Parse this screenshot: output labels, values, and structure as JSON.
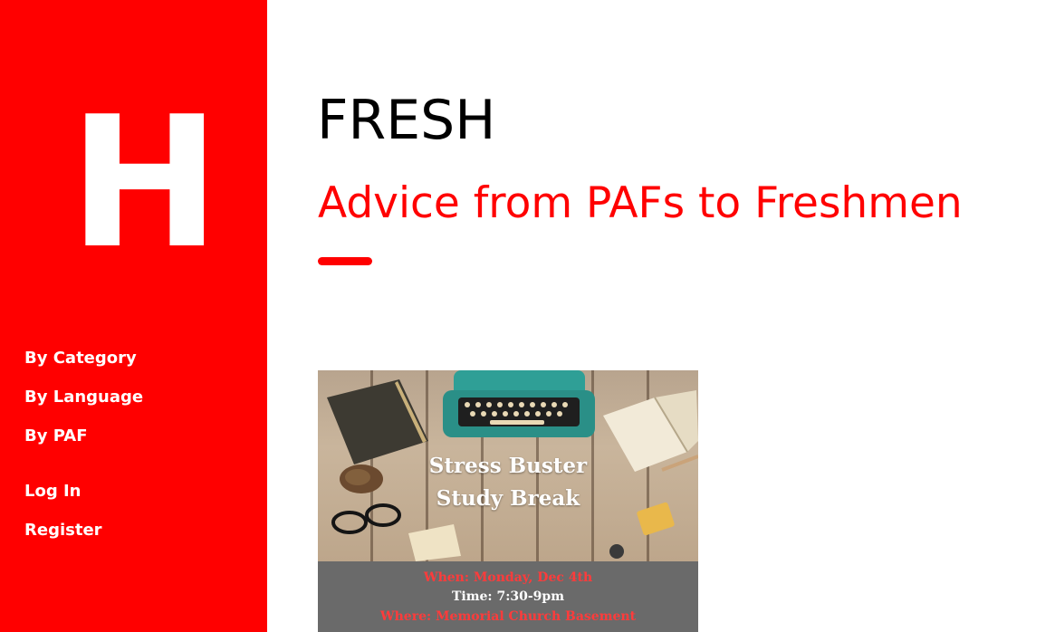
{
  "sidebar": {
    "logo_letter": "H",
    "nav": [
      {
        "label": "By Category"
      },
      {
        "label": "By Language"
      },
      {
        "label": "By PAF"
      }
    ],
    "account": [
      {
        "label": "Log In"
      },
      {
        "label": "Register"
      }
    ]
  },
  "header": {
    "title": "FRESH",
    "subtitle": "Advice from PAFs to Freshmen"
  },
  "post": {
    "flyer": {
      "headline_line1": "Stress Buster",
      "headline_line2": "Study Break",
      "when": "When: Monday, Dec 4th",
      "time": "Time: 7:30-9pm",
      "where": "Where: Memorial Church Basement"
    }
  },
  "colors": {
    "accent": "#ff0000",
    "sidebar_text": "#ffffff",
    "flyer_info_bg": "#6a6a6a"
  }
}
